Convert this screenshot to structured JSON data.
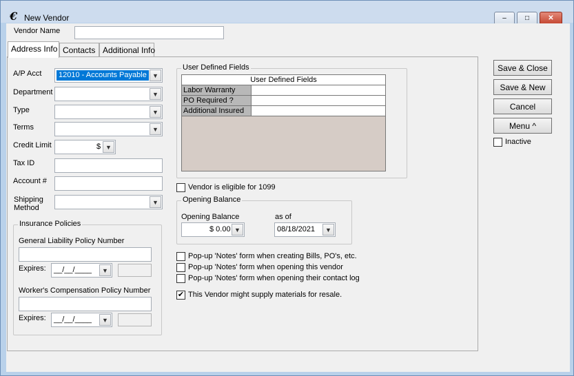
{
  "window": {
    "title": "New Vendor",
    "minimize": "–",
    "maximize": "□",
    "close": "✕"
  },
  "vendor_name": {
    "label": "Vendor Name",
    "value": ""
  },
  "tabs": [
    {
      "label": "Address Info"
    },
    {
      "label": "Contacts"
    },
    {
      "label": "Additional Info"
    }
  ],
  "form": {
    "ap_acct": {
      "label": "A/P Acct",
      "value": "12010 - Accounts Payable"
    },
    "department": {
      "label": "Department",
      "value": ""
    },
    "type": {
      "label": "Type",
      "value": ""
    },
    "terms": {
      "label": "Terms",
      "value": ""
    },
    "credit_limit": {
      "label": "Credit Limit",
      "value": "$"
    },
    "tax_id": {
      "label": "Tax ID",
      "value": ""
    },
    "account_no": {
      "label": "Account #",
      "value": ""
    },
    "shipping_method": {
      "label_line1": "Shipping",
      "label_line2": "Method",
      "value": ""
    }
  },
  "insurance": {
    "title": "Insurance Policies",
    "gl_label": "General Liability Policy Number",
    "gl_value": "",
    "gl_expires_label": "Expires:",
    "gl_expires_value": "__/__/____",
    "wc_label": "Worker's Compensation Policy Number",
    "wc_value": "",
    "wc_expires_label": "Expires:",
    "wc_expires_value": "__/__/____"
  },
  "udf": {
    "group_title": "User Defined Fields",
    "table_header": "User Defined Fields",
    "rows": [
      {
        "label": "Labor Warranty",
        "value": ""
      },
      {
        "label": "PO Required ?",
        "value": ""
      },
      {
        "label": "Additional Insured",
        "value": ""
      }
    ]
  },
  "eligible_1099": {
    "label": "Vendor is eligible for 1099",
    "checked": false
  },
  "opening_balance": {
    "group_title": "Opening Balance",
    "amount_label": "Opening Balance",
    "amount_value": "$ 0.00",
    "asof_label": "as of",
    "asof_value": "08/18/2021"
  },
  "popups": [
    {
      "label": "Pop-up 'Notes' form when creating Bills, PO's, etc.",
      "checked": false
    },
    {
      "label": "Pop-up 'Notes' form when opening this vendor",
      "checked": false
    },
    {
      "label": "Pop-up 'Notes' form when opening their contact log",
      "checked": false
    }
  ],
  "resale": {
    "label": "This Vendor might supply materials for resale.",
    "checked": true,
    "mark": "✔"
  },
  "buttons": {
    "save_close": "Save & Close",
    "save_new": "Save & New",
    "cancel": "Cancel",
    "menu": "Menu ^"
  },
  "inactive": {
    "label": "Inactive",
    "checked": false
  },
  "icons": {
    "app": "vendor-app-icon",
    "dropdown": "chevron-down-icon"
  },
  "colors": {
    "selection": "#0078d7",
    "titlebar": "#cddcee",
    "close": "#c3452f"
  }
}
